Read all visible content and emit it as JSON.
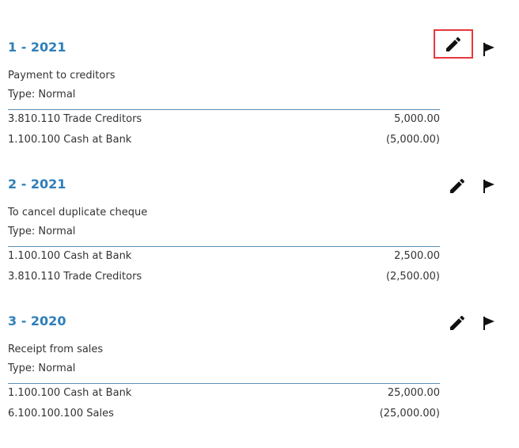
{
  "journals": [
    {
      "title": "1 - 2021",
      "description": "Payment to creditors",
      "type": "Type: Normal",
      "lines": [
        {
          "account": "3.810.110 Trade Creditors",
          "amount": "5,000.00"
        },
        {
          "account": "1.100.100 Cash at Bank",
          "amount": "(5,000.00)"
        }
      ],
      "actions": {
        "edit_icon": "pencil-icon",
        "flag_icon": "flag-icon",
        "edit_highlighted": true
      }
    },
    {
      "title": "2 - 2021",
      "description": "To cancel duplicate cheque",
      "type": "Type: Normal",
      "lines": [
        {
          "account": "1.100.100 Cash at Bank",
          "amount": "2,500.00"
        },
        {
          "account": "3.810.110 Trade Creditors",
          "amount": "(2,500.00)"
        }
      ],
      "actions": {
        "edit_icon": "pencil-icon",
        "flag_icon": "flag-icon",
        "edit_highlighted": false
      }
    },
    {
      "title": "3 - 2020",
      "description": "Receipt from sales",
      "type": "Type: Normal",
      "lines": [
        {
          "account": "1.100.100 Cash at Bank",
          "amount": "25,000.00"
        },
        {
          "account": "6.100.100.100 Sales",
          "amount": "(25,000.00)"
        }
      ],
      "actions": {
        "edit_icon": "pencil-icon",
        "flag_icon": "flag-icon",
        "edit_highlighted": false
      }
    }
  ],
  "colors": {
    "title": "#2f7fb9",
    "text": "#333333",
    "divider": "#5b8fb4",
    "highlight_border": "#e8373d",
    "icon": "#111111"
  }
}
